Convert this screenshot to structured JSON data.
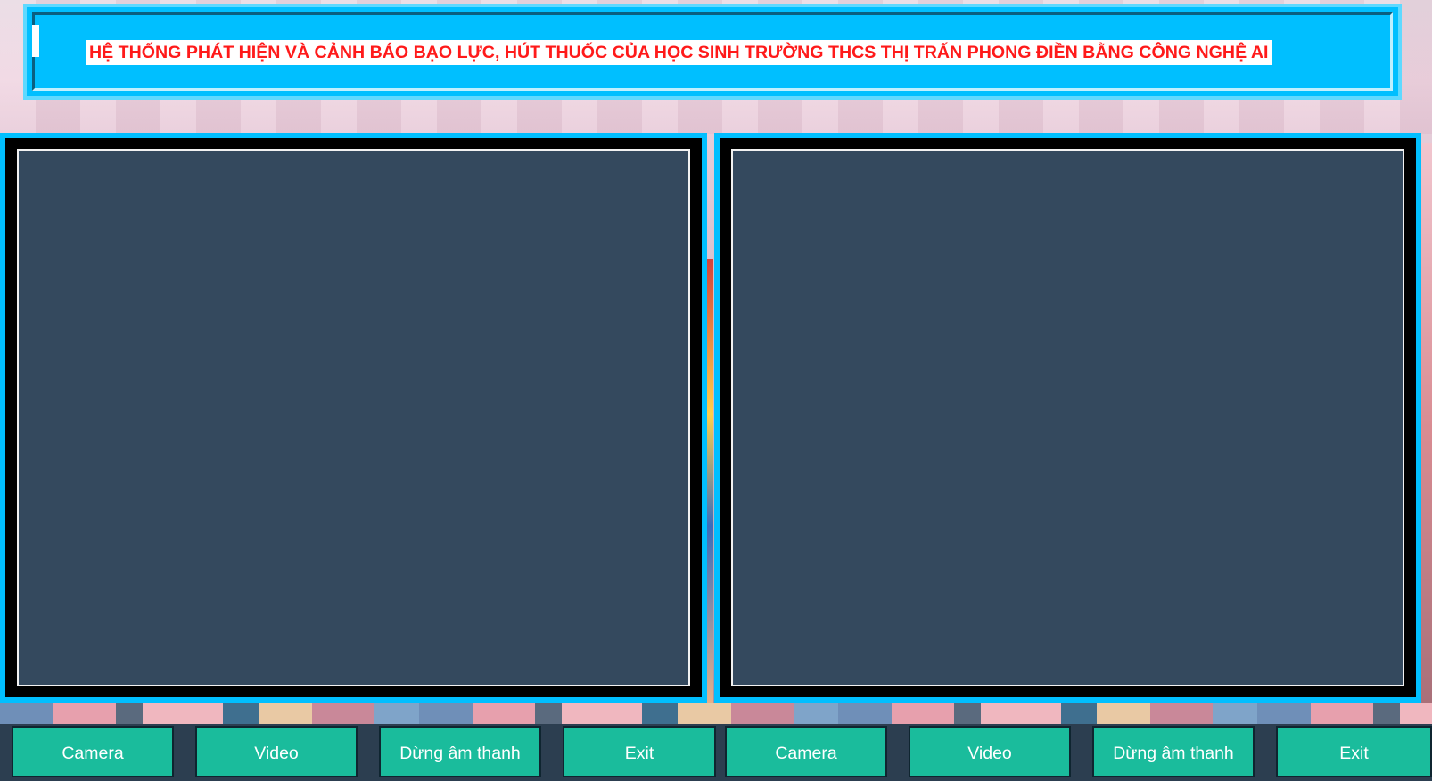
{
  "title": {
    "text": "HỆ THỐNG PHÁT HIỆN VÀ CẢNH BÁO BẠO LỰC, HÚT THUỐC CỦA HỌC SINH TRƯỜNG THCS THỊ TRẤN PHONG ĐIỀN BẰNG CÔNG NGHỆ AI"
  },
  "left_panel": {
    "buttons": {
      "camera": "Camera",
      "video": "Video",
      "stop_sound": "Dừng âm thanh",
      "exit": "Exit"
    }
  },
  "right_panel": {
    "buttons": {
      "camera": "Camera",
      "video": "Video",
      "stop_sound": "Dừng âm thanh",
      "exit": "Exit"
    }
  },
  "colors": {
    "title_background": "#00bfff",
    "title_text": "#ff1a1a",
    "panel_border": "#00bfff",
    "screen_background": "#34495e",
    "button_background": "#1abc9c",
    "button_bar": "#2c3e50"
  }
}
